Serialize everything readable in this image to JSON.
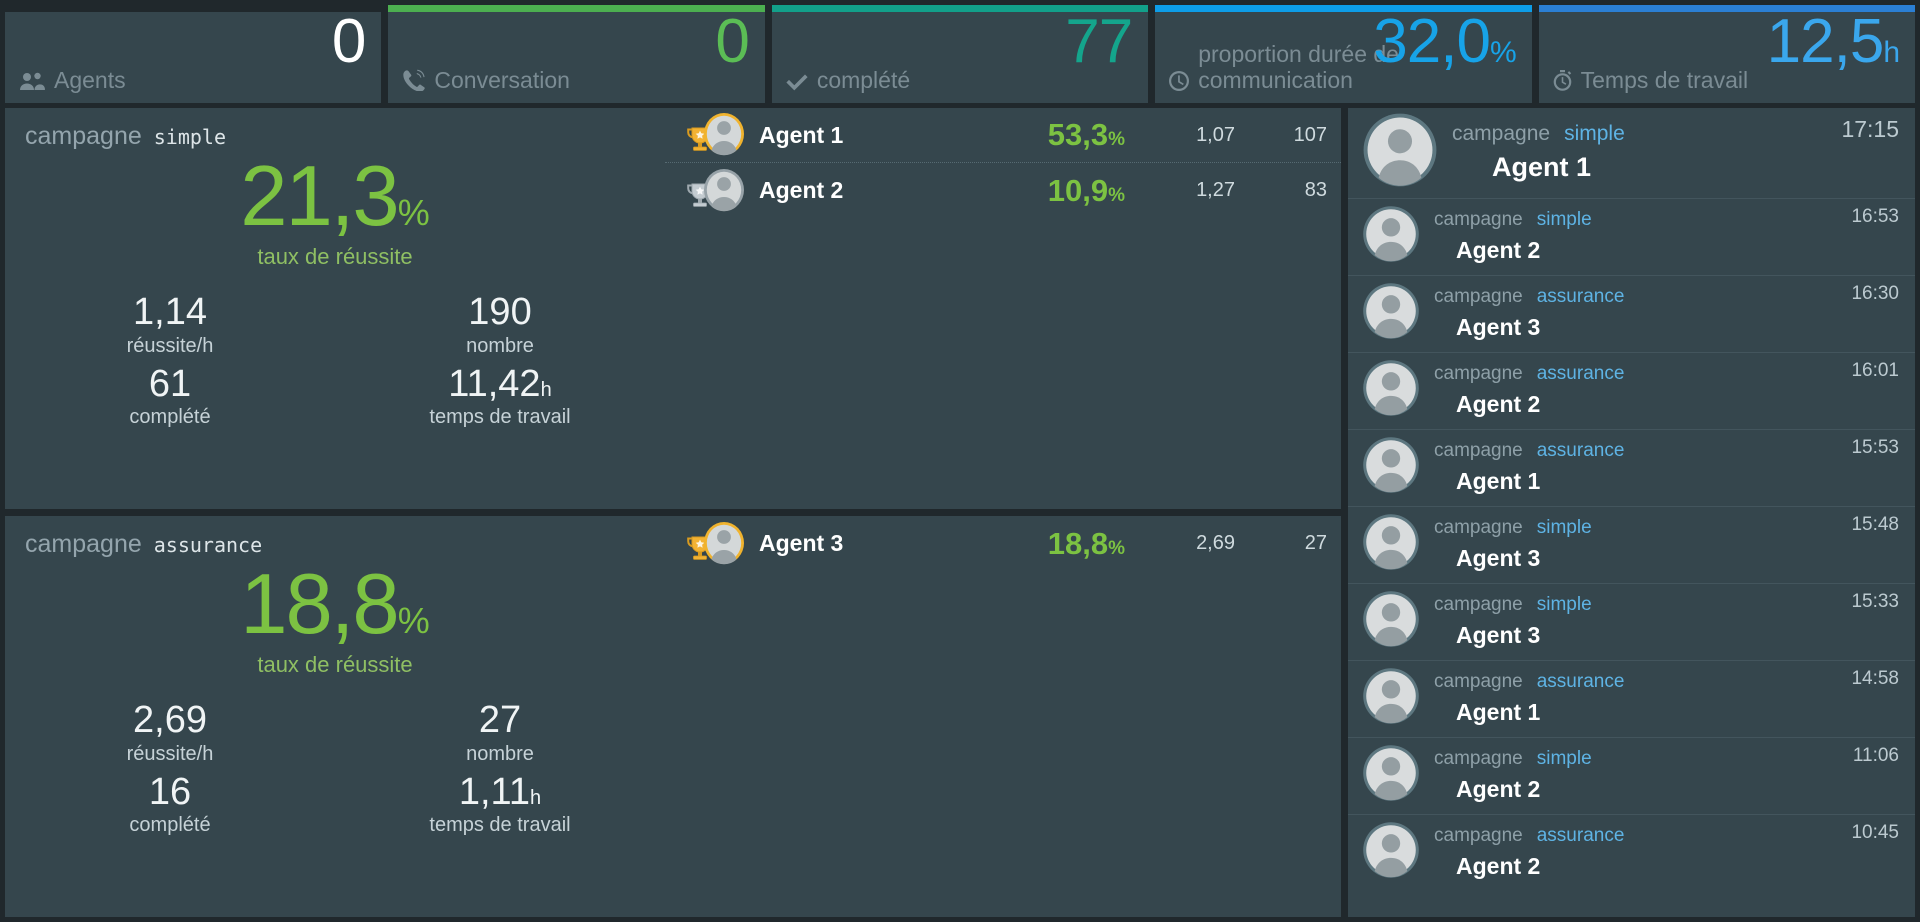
{
  "kpis": [
    {
      "icon": "users-icon",
      "label": "Agents",
      "value": "0",
      "unit": "",
      "value_color": "#ffffff",
      "accent": "#20282c"
    },
    {
      "icon": "phone-icon",
      "label": "Conversation",
      "value": "0",
      "unit": "",
      "value_color": "#5bbd55",
      "accent": "#4CAF50"
    },
    {
      "icon": "check-icon",
      "label": "complété",
      "value": "77",
      "unit": "",
      "value_color": "#14a58c",
      "accent": "#12A08A"
    },
    {
      "icon": "clock-icon",
      "label": "proportion durée de communication",
      "value": "32,0",
      "unit": "%",
      "value_color": "#17a3e8",
      "accent": "#0D9DE8"
    },
    {
      "icon": "stopwatch-icon",
      "label": "Temps de travail",
      "value": "12,5",
      "unit": "h",
      "value_color": "#3aa7ed",
      "accent": "#2b7fd4"
    }
  ],
  "campaigns": [
    {
      "head_label": "campagne",
      "name": "simple",
      "rate": "21,3",
      "rate_unit": "%",
      "rate_sub": "taux de réussite",
      "metrics": [
        {
          "value": "1,14",
          "suffix": "",
          "label": "réussite/h"
        },
        {
          "value": "190",
          "suffix": "",
          "label": "nombre"
        },
        {
          "value": "61",
          "suffix": "",
          "label": "complété"
        },
        {
          "value": "11,42",
          "suffix": "h",
          "label": "temps de travail"
        }
      ],
      "agents": [
        {
          "medal": "gold",
          "name": "Agent 1",
          "pct": "53,3",
          "pct_unit": "%",
          "rate": "1,07",
          "count": "107"
        },
        {
          "medal": "silver",
          "name": "Agent 2",
          "pct": "10,9",
          "pct_unit": "%",
          "rate": "1,27",
          "count": "83"
        }
      ]
    },
    {
      "head_label": "campagne",
      "name": "assurance",
      "rate": "18,8",
      "rate_unit": "%",
      "rate_sub": "taux de réussite",
      "metrics": [
        {
          "value": "2,69",
          "suffix": "",
          "label": "réussite/h"
        },
        {
          "value": "27",
          "suffix": "",
          "label": "nombre"
        },
        {
          "value": "16",
          "suffix": "",
          "label": "complété"
        },
        {
          "value": "1,11",
          "suffix": "h",
          "label": "temps de travail"
        }
      ],
      "agents": [
        {
          "medal": "gold",
          "name": "Agent 3",
          "pct": "18,8",
          "pct_unit": "%",
          "rate": "2,69",
          "count": "27"
        }
      ]
    }
  ],
  "feed": {
    "campaign_label": "campagne",
    "items": [
      {
        "campaign": "simple",
        "agent": "Agent 1",
        "time": "17:15",
        "size": "big"
      },
      {
        "campaign": "simple",
        "agent": "Agent 2",
        "time": "16:53",
        "size": "small"
      },
      {
        "campaign": "assurance",
        "agent": "Agent 3",
        "time": "16:30",
        "size": "small"
      },
      {
        "campaign": "assurance",
        "agent": "Agent 2",
        "time": "16:01",
        "size": "small"
      },
      {
        "campaign": "assurance",
        "agent": "Agent 1",
        "time": "15:53",
        "size": "small"
      },
      {
        "campaign": "simple",
        "agent": "Agent 3",
        "time": "15:48",
        "size": "small"
      },
      {
        "campaign": "simple",
        "agent": "Agent 3",
        "time": "15:33",
        "size": "small"
      },
      {
        "campaign": "assurance",
        "agent": "Agent 1",
        "time": "14:58",
        "size": "small"
      },
      {
        "campaign": "simple",
        "agent": "Agent 2",
        "time": "11:06",
        "size": "small"
      },
      {
        "campaign": "assurance",
        "agent": "Agent 2",
        "time": "10:45",
        "size": "small"
      }
    ]
  }
}
